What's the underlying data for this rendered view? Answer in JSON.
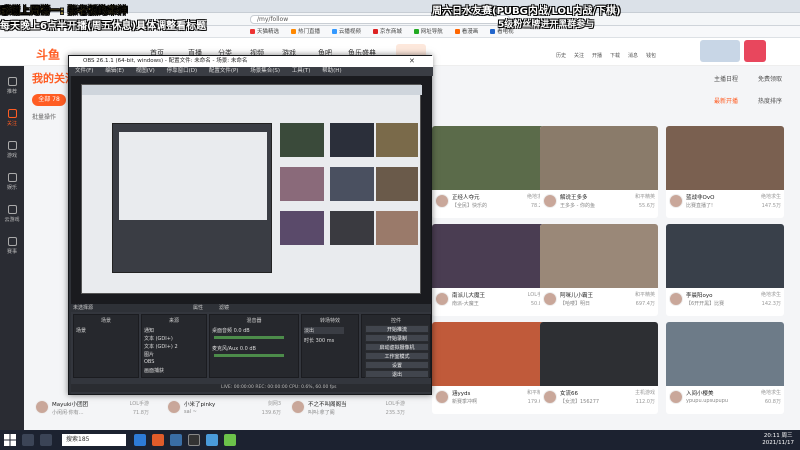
{
  "browser": {
    "url": "/my/follow",
    "bookmarks": [
      "天猫精选",
      "热门直播",
      "云播视频",
      "京东商城",
      "网址导航",
      "看漫画",
      "看电视"
    ]
  },
  "site": {
    "logo": "斗鱼",
    "nav": [
      "首页",
      "直播",
      "分类",
      "视频",
      "游戏",
      "鱼吧",
      "鱼乐盛典"
    ],
    "user_actions": [
      "历史",
      "关注",
      "开播",
      "下载",
      "消息",
      "钱包"
    ]
  },
  "rail": [
    "推荐",
    "关注",
    "游戏",
    "娱乐",
    "云游戏",
    "赛事"
  ],
  "page": {
    "title": "我的关注",
    "filter_all": "全部 78",
    "bulk": "批量操作",
    "right_buttons": [
      "主播日程",
      "免费领取"
    ],
    "sort_tabs": [
      "最新开播",
      "热度排序"
    ]
  },
  "cards": [
    {
      "title": "正经人夺元",
      "game": "绝地求生",
      "name": "【全民】快乐的",
      "heat": "78.2万",
      "thumb": "#5b6b4a"
    },
    {
      "title": "解说王多多",
      "game": "和平精英",
      "name": "王多多 - 你的鱼",
      "heat": "55.6万",
      "thumb": "#8a7b6a"
    },
    {
      "title": "蓝战非OvO",
      "game": "绝地求生",
      "name": "比赛直播了!",
      "heat": "147.5万",
      "thumb": "#7a6050"
    },
    {
      "title": "南派儿大魔王",
      "game": "LOL手游",
      "name": "南派-大魔王",
      "heat": "50.8万",
      "thumb": "#4a3d52"
    },
    {
      "title": "阿咪儿小霸王",
      "game": "和平精英",
      "name": "【哈喽】明日",
      "heat": "697.4万",
      "thumb": "#9a8878"
    },
    {
      "title": "李晨阳oyo",
      "game": "绝地求生",
      "name": "【6开开黑】比赛",
      "heat": "142.3万",
      "thumb": "#39404a"
    },
    {
      "title": "涵yyds",
      "game": "和平精英",
      "name": "新赛季冲啊",
      "heat": "179.6万",
      "thumb": "#c05a3a"
    },
    {
      "title": "女流66",
      "game": "主机游戏",
      "name": "【女流】156277",
      "heat": "112.0万",
      "thumb": "#2d2f33"
    },
    {
      "title": "入间小樱美",
      "game": "绝地求生",
      "name": "ypupu.upsupupu",
      "heat": "60.8万",
      "thumb": "#6d7b88"
    }
  ],
  "cards_left": [
    {
      "title": "Mayuki小团团",
      "game": "LOL手游",
      "name": "小闲闲·你有…",
      "heat": "71.8万"
    },
    {
      "title": "小米了pinky",
      "game": "剑网3",
      "name": "sal ~",
      "heat": "139.6万"
    },
    {
      "title": "不之不叫阁阁当",
      "game": "LOL手游",
      "name": "叫叫:拿了阁",
      "heat": "235.3万"
    }
  ],
  "obs": {
    "title": "OBS 26.1.1 (64-bit, windows) - 配置文件: 未命名 - 场景: 未命名",
    "menu": [
      "文件(F)",
      "编辑(E)",
      "视图(V)",
      "停靠窗口(D)",
      "配置文件(P)",
      "场景集合(S)",
      "工具(T)",
      "帮助(H)"
    ],
    "no_source": "未选择源",
    "props": "属性",
    "filters": "滤镜",
    "docks": {
      "scenes": {
        "head": "场景",
        "items": [
          "场景"
        ]
      },
      "sources": {
        "head": "来源",
        "items": [
          "通知",
          "文本 (GDI+)",
          "文本 (GDI+) 2",
          "图片",
          "OBS",
          "画面捕获"
        ]
      },
      "mixer": {
        "head": "混音器",
        "items": [
          "桌面音频  0.0 dB",
          "麦克风/Aux  0.0 dB"
        ]
      },
      "transitions": {
        "head": "转场特效",
        "items": [
          "淡出",
          "时长 300 ms"
        ]
      },
      "controls": {
        "head": "控件",
        "buttons": [
          "开始推流",
          "开始录制",
          "启动虚拟摄像机",
          "工作室模式",
          "设置",
          "退出"
        ]
      }
    },
    "status": "LIVE: 00:00:00   REC: 00:00:00   CPU: 0.6%, 60.00 fps"
  },
  "overlay": {
    "left1": "感谢上周榜一: 张老板的米神",
    "left2": "每天晚上6点半开播(周五休息)具体调整看标题",
    "right1": "周六日水友赛(PUBG内战/LOL内战/下棋)",
    "right2": "5级粉丝牌进开黑群参与"
  },
  "taskbar": {
    "search": "搜索185",
    "time": "20:11 周三",
    "date": "2021/11/17"
  }
}
